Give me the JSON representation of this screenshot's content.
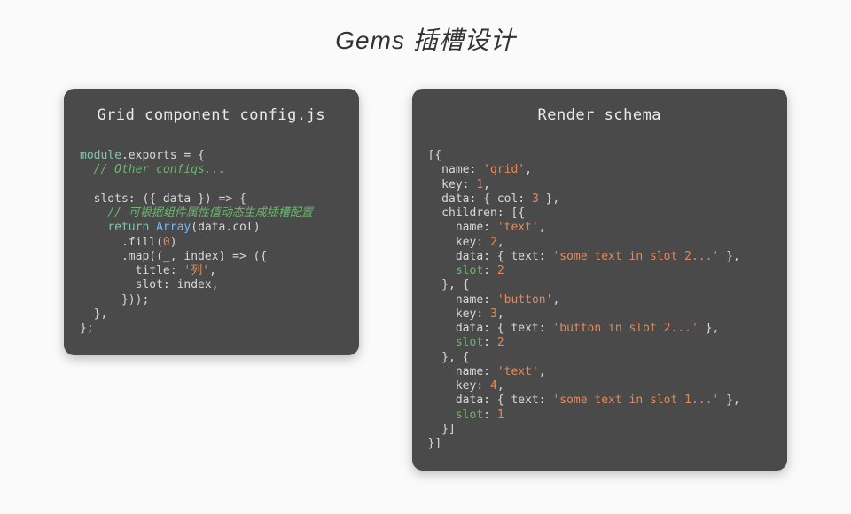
{
  "header": {
    "title": "Gems 插槽设计"
  },
  "leftCard": {
    "title": "Grid component config.js"
  },
  "rightCard": {
    "title": "Render schema"
  },
  "code": {
    "left": {
      "l1a": "module",
      "l1b": ".exports = {",
      "l2": "  // Other configs...",
      "l3": "",
      "l4": "  slots: ({ data }) => {",
      "l5": "    // 可根据组件属性值动态生成插槽配置",
      "l6a": "    ",
      "l6b": "return",
      "l6c": " ",
      "l6d": "Array",
      "l6e": "(data.col)",
      "l7a": "      .fill(",
      "l7b": "0",
      "l7c": ")",
      "l8": "      .map((_, index) => ({",
      "l9a": "        title: ",
      "l9b": "'列'",
      "l9c": ",",
      "l10": "        slot: index,",
      "l11": "      }));",
      "l12": "  },",
      "l13": "};"
    },
    "right": {
      "r1": "[{",
      "r2a": "  name: ",
      "r2b": "'grid'",
      "r2c": ",",
      "r3a": "  key: ",
      "r3b": "1",
      "r3c": ",",
      "r4a": "  data: { col: ",
      "r4b": "3",
      "r4c": " },",
      "r5": "  children: [{",
      "r6a": "    name: ",
      "r6b": "'text'",
      "r6c": ",",
      "r7a": "    key: ",
      "r7b": "2",
      "r7c": ",",
      "r8a": "    data: { text: ",
      "r8b": "'some text in slot 2...'",
      "r8c": " },",
      "r9a": "    ",
      "r9b": "slot",
      "r9c": ": ",
      "r9d": "2",
      "r10": "  }, {",
      "r11a": "    name: ",
      "r11b": "'button'",
      "r11c": ",",
      "r12a": "    key: ",
      "r12b": "3",
      "r12c": ",",
      "r13a": "    data: { text: ",
      "r13b": "'button in slot 2...'",
      "r13c": " },",
      "r14a": "    ",
      "r14b": "slot",
      "r14c": ": ",
      "r14d": "2",
      "r15": "  }, {",
      "r16a": "    name: ",
      "r16b": "'text'",
      "r16c": ",",
      "r17a": "    key: ",
      "r17b": "4",
      "r17c": ",",
      "r18a": "    data: { text: ",
      "r18b": "'some text in slot 1...'",
      "r18c": " },",
      "r19a": "    ",
      "r19b": "slot",
      "r19c": ": ",
      "r19d": "1",
      "r20": "  }]",
      "r21": "}]"
    }
  }
}
